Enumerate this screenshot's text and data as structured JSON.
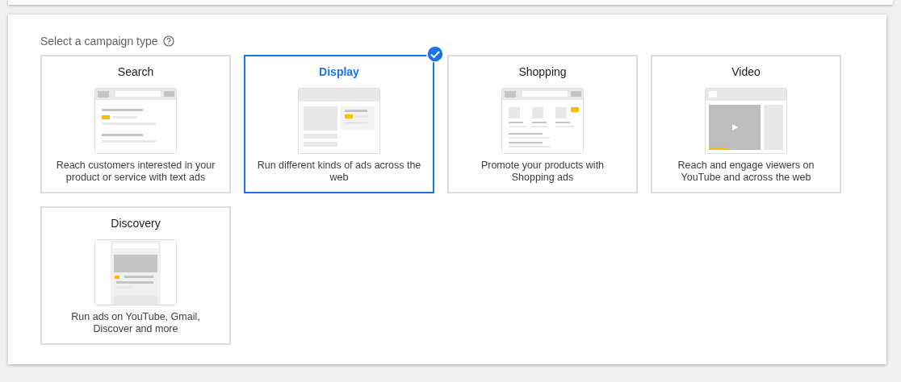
{
  "heading": "Select a campaign type",
  "campaign_types": [
    {
      "kind": "search",
      "title": "Search",
      "description": "Reach customers interested in your product or service with text ads",
      "selected": false
    },
    {
      "kind": "display",
      "title": "Display",
      "description": "Run different kinds of ads across the web",
      "selected": true
    },
    {
      "kind": "shopping",
      "title": "Shopping",
      "description": "Promote your products with Shopping ads",
      "selected": false
    },
    {
      "kind": "video",
      "title": "Video",
      "description": "Reach and engage viewers on YouTube and across the web",
      "selected": false
    },
    {
      "kind": "discovery",
      "title": "Discovery",
      "description": "Run ads on YouTube, Gmail, Discover and more",
      "selected": false
    }
  ]
}
